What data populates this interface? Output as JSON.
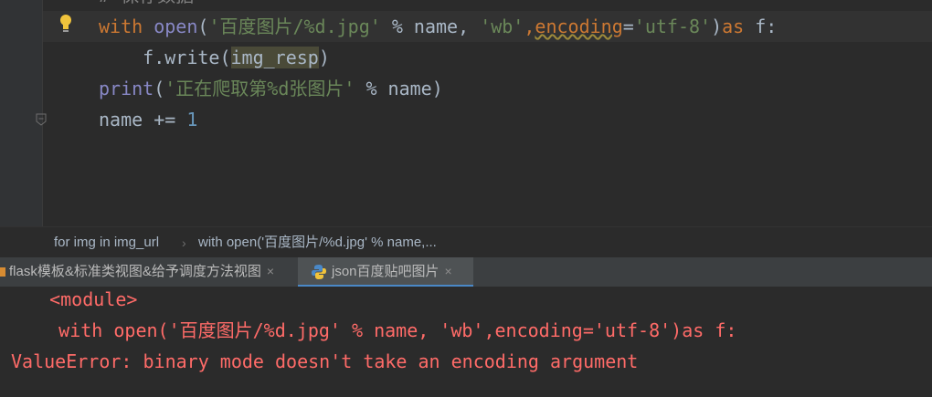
{
  "editor": {
    "partial_comment": "# 保存数据",
    "line1": {
      "kw_with": "with",
      "fn_open": "open",
      "paren_open": "(",
      "str_path": "'百度图片/%d.jpg'",
      "op1": " % name, ",
      "str_mode": "'wb'",
      "comma": ",",
      "param": "encoding",
      "eq": "=",
      "str_enc": "'utf-8'",
      "paren_close": ")",
      "kw_as": "as",
      "tail": " f:"
    },
    "line2": {
      "prefix": "    f.write(",
      "var": "img_resp",
      "suffix": ")"
    },
    "line3": {
      "fn": "print",
      "open": "(",
      "str": "'正在爬取第%d张图片'",
      "rest": " % name)"
    },
    "line4": {
      "text": "name += ",
      "num": "1"
    }
  },
  "breadcrumb": {
    "items": [
      "for img in img_url",
      "with open('百度图片/%d.jpg' % name,..."
    ],
    "separator": "›"
  },
  "tabs": [
    {
      "label": "flask模板&标准类视图&给予调度方法视图",
      "active": false
    },
    {
      "label": "json百度贴吧图片",
      "active": true
    }
  ],
  "tab_close": "×",
  "console": {
    "lines": [
      "  <module>",
      "    with open('百度图片/%d.jpg' % name, 'wb',encoding='utf-8')as f:",
      "ValueError: binary mode doesn't take an encoding argument"
    ]
  },
  "colors": {
    "error": "#ff6b68",
    "keyword": "#cc7832",
    "string": "#6a8759",
    "number": "#6897bb",
    "active_tab_underline": "#4a88c7"
  }
}
